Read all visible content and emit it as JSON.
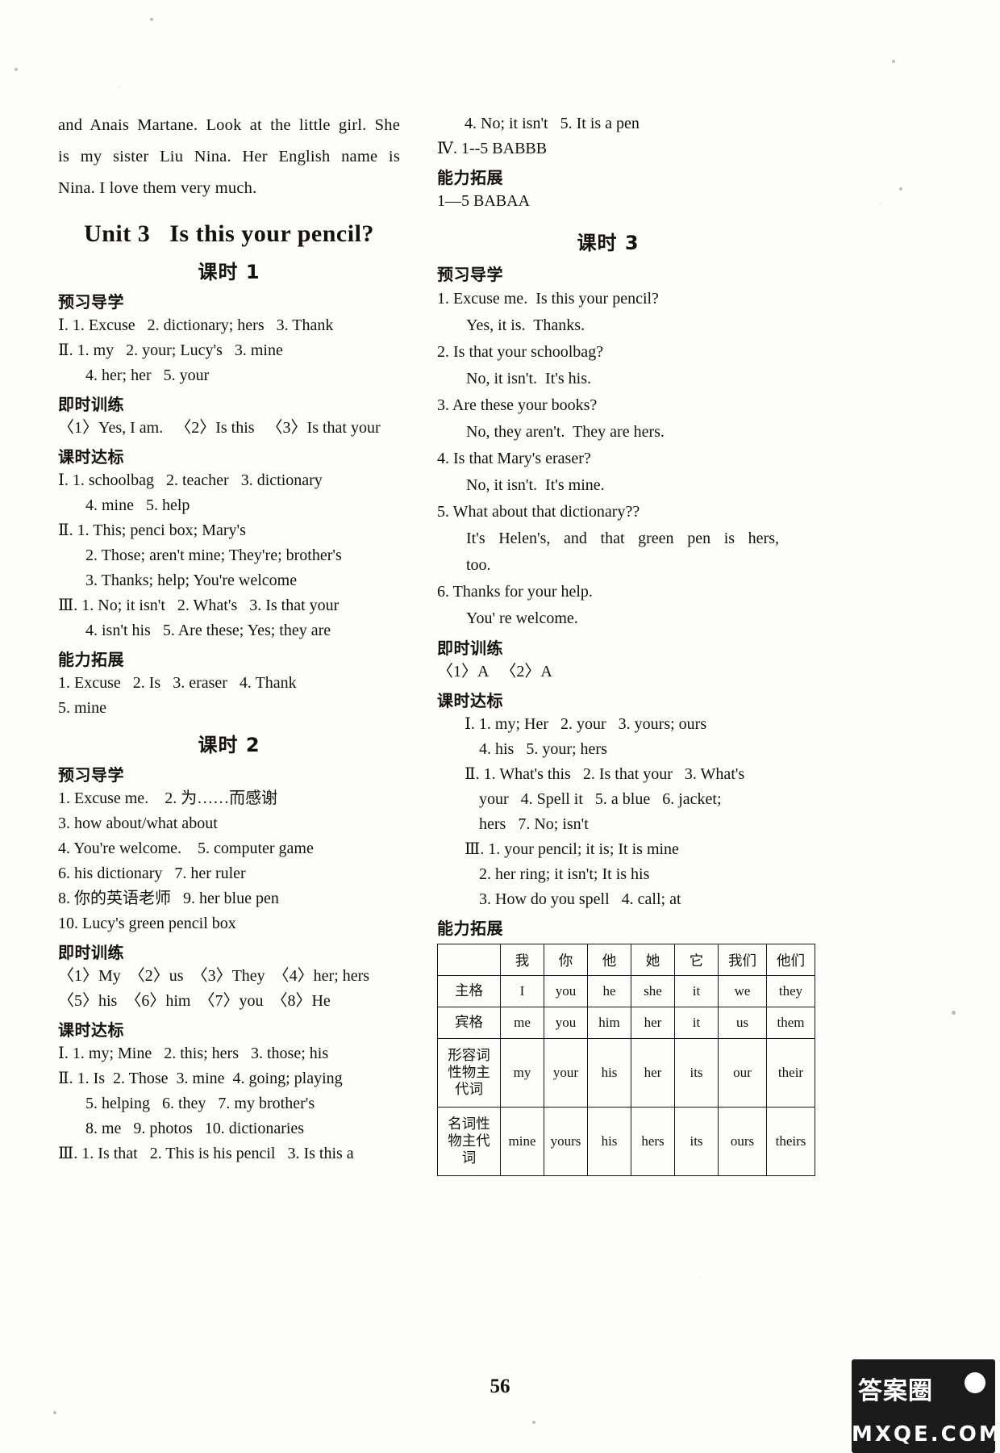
{
  "page": {
    "number": "56",
    "watermark_cn": "答案圈",
    "watermark_en": "MXQE.COM"
  },
  "intro_paragraph": {
    "line1": "and Anais Martane. Look at the little girl. She",
    "line2": "is my sister Liu Nina. Her English name is",
    "line3": "Nina. I love them very much."
  },
  "unit": {
    "number": "Unit 3",
    "title": "Is this your pencil?"
  },
  "labels": {
    "keshi1": "课时 1",
    "keshi2": "课时 2",
    "keshi3": "课时 3",
    "yuxi": "预习导学",
    "jishi": "即时训练",
    "keshidabiao": "课时达标",
    "nengli": "能力拓展"
  },
  "lesson1": {
    "yuxi": [
      "Ⅰ. 1. Excuse   2. dictionary; hers   3. Thank",
      "Ⅱ. 1. my   2. your; Lucy's   3. mine",
      "4. her; her   5. your"
    ],
    "jishi": [
      "〈1〉Yes, I am.   〈2〉Is this   〈3〉Is that your"
    ],
    "dabiao": [
      "Ⅰ. 1. schoolbag   2. teacher   3. dictionary",
      "4. mine   5. help",
      "Ⅱ. 1. This; penci box; Mary's",
      "2. Those; aren't mine; They're; brother's",
      "3. Thanks; help; You're welcome",
      "Ⅲ. 1. No; it isn't   2. What's   3. Is that your",
      "4. isn't his   5. Are these; Yes; they are"
    ],
    "nengli": [
      "1. Excuse   2. Is   3. eraser   4. Thank",
      "5. mine"
    ]
  },
  "lesson2": {
    "yuxi": [
      "1. Excuse me.    2. 为……而感谢",
      "3. how about/what about",
      "4. You're welcome.    5. computer game",
      "6. his dictionary   7. her ruler",
      "8. 你的英语老师   9. her blue pen",
      "10. Lucy's green pencil box"
    ],
    "jishi": [
      "〈1〉My  〈2〉us  〈3〉They  〈4〉her; hers",
      "〈5〉his  〈6〉him  〈7〉you  〈8〉He"
    ],
    "dabiao": [
      "Ⅰ. 1. my; Mine   2. this; hers   3. those; his",
      "Ⅱ. 1. Is  2. Those  3. mine  4. going; playing",
      "5. helping   6. they   7. my brother's",
      "8. me   9. photos   10. dictionaries",
      "Ⅲ. 1. Is that   2. This is his pencil   3. Is this a",
      "4. No; it isn't   5. It is a pen",
      "Ⅳ. 1--5 BABBB"
    ],
    "nengli": [
      "1—5 BABAA"
    ]
  },
  "lesson3": {
    "yuxi": [
      {
        "n": "1.",
        "q": "Excuse me.  Is this your pencil?",
        "a": "Yes, it is.  Thanks."
      },
      {
        "n": "2.",
        "q": "Is that your schoolbag?",
        "a": "No, it isn't.  It's his."
      },
      {
        "n": "3.",
        "q": "Are these your books?",
        "a": "No, they aren't.  They are hers."
      },
      {
        "n": "4.",
        "q": "Is that Mary's eraser?",
        "a": "No, it isn't.  It's mine."
      },
      {
        "n": "5.",
        "q": "What about that dictionary??",
        "a": "It's Helen's, and that green pen is hers,",
        "a2": "too."
      },
      {
        "n": "6.",
        "q": "Thanks for your help.",
        "a": "You' re welcome."
      }
    ],
    "jishi": [
      "〈1〉A   〈2〉A"
    ],
    "dabiao": [
      "Ⅰ. 1. my; Her   2. your   3. yours; ours",
      "4. his   5. your; hers",
      "Ⅱ. 1. What's this   2. Is that your   3. What's",
      "your   4. Spell it   5. a blue   6. jacket;",
      "hers   7. No; isn't",
      "Ⅲ. 1. your pencil; it is; It is mine",
      "2. her ring; it isn't; It is his",
      "3. How do you spell   4. call; at"
    ]
  },
  "pronoun_table": {
    "column_headers": [
      "",
      "我",
      "你",
      "他",
      "她",
      "它",
      "我们",
      "他们"
    ],
    "rows": [
      {
        "label": "主格",
        "cells": [
          "I",
          "you",
          "he",
          "she",
          "it",
          "we",
          "they"
        ]
      },
      {
        "label": "宾格",
        "cells": [
          "me",
          "you",
          "him",
          "her",
          "it",
          "us",
          "them"
        ]
      },
      {
        "label": "形容词\n性物主\n代词",
        "cells": [
          "my",
          "your",
          "his",
          "her",
          "its",
          "our",
          "their"
        ]
      },
      {
        "label": "名词性\n物主代\n词",
        "cells": [
          "mine",
          "yours",
          "his",
          "hers",
          "its",
          "ours",
          "theirs"
        ]
      }
    ]
  }
}
